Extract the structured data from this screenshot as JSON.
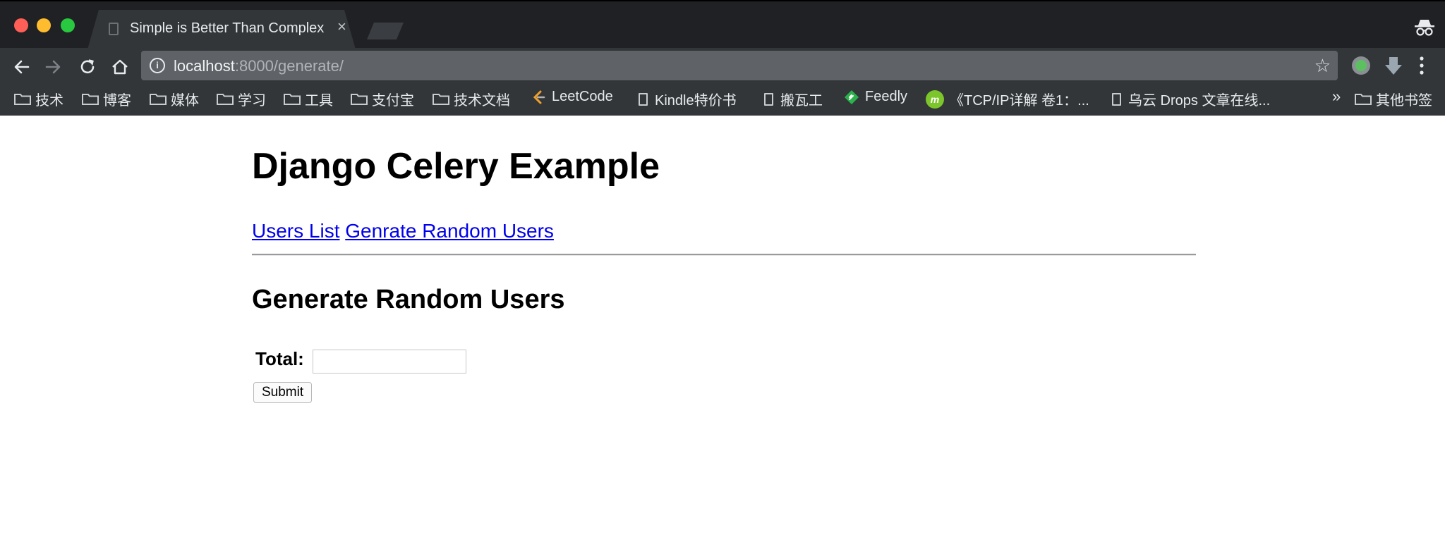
{
  "browser": {
    "tab_title": "Simple is Better Than Complex",
    "tab_close": "×",
    "url_host": "localhost",
    "url_rest": ":8000/generate/",
    "bookmarks": [
      {
        "label": "技术",
        "icon": "folder-icon"
      },
      {
        "label": "博客",
        "icon": "folder-icon"
      },
      {
        "label": "媒体",
        "icon": "folder-icon"
      },
      {
        "label": "学习",
        "icon": "folder-icon"
      },
      {
        "label": "工具",
        "icon": "folder-icon"
      },
      {
        "label": "支付宝",
        "icon": "folder-icon"
      },
      {
        "label": "技术文档",
        "icon": "folder-icon"
      },
      {
        "label": "LeetCode",
        "icon": "leetcode-icon"
      },
      {
        "label": "Kindle特价书",
        "icon": "page-icon"
      },
      {
        "label": "搬瓦工",
        "icon": "page-icon"
      },
      {
        "label": "Feedly",
        "icon": "feedly-icon"
      },
      {
        "label": "《TCP/IP详解 卷1：...",
        "icon": "m-icon"
      },
      {
        "label": "乌云 Drops 文章在线...",
        "icon": "page-icon"
      }
    ],
    "overflow_chevrons": "»",
    "other_bookmarks": "其他书签"
  },
  "page": {
    "title": "Django Celery Example",
    "nav": {
      "users_list": "Users List",
      "generate_users": "Genrate Random Users"
    },
    "heading": "Generate Random Users",
    "form": {
      "total_label": "Total:",
      "total_value": "",
      "submit_label": "Submit"
    }
  },
  "colors": {
    "chrome_bg": "#323639",
    "tabstrip_bg": "#202124",
    "link": "#0000ee"
  }
}
